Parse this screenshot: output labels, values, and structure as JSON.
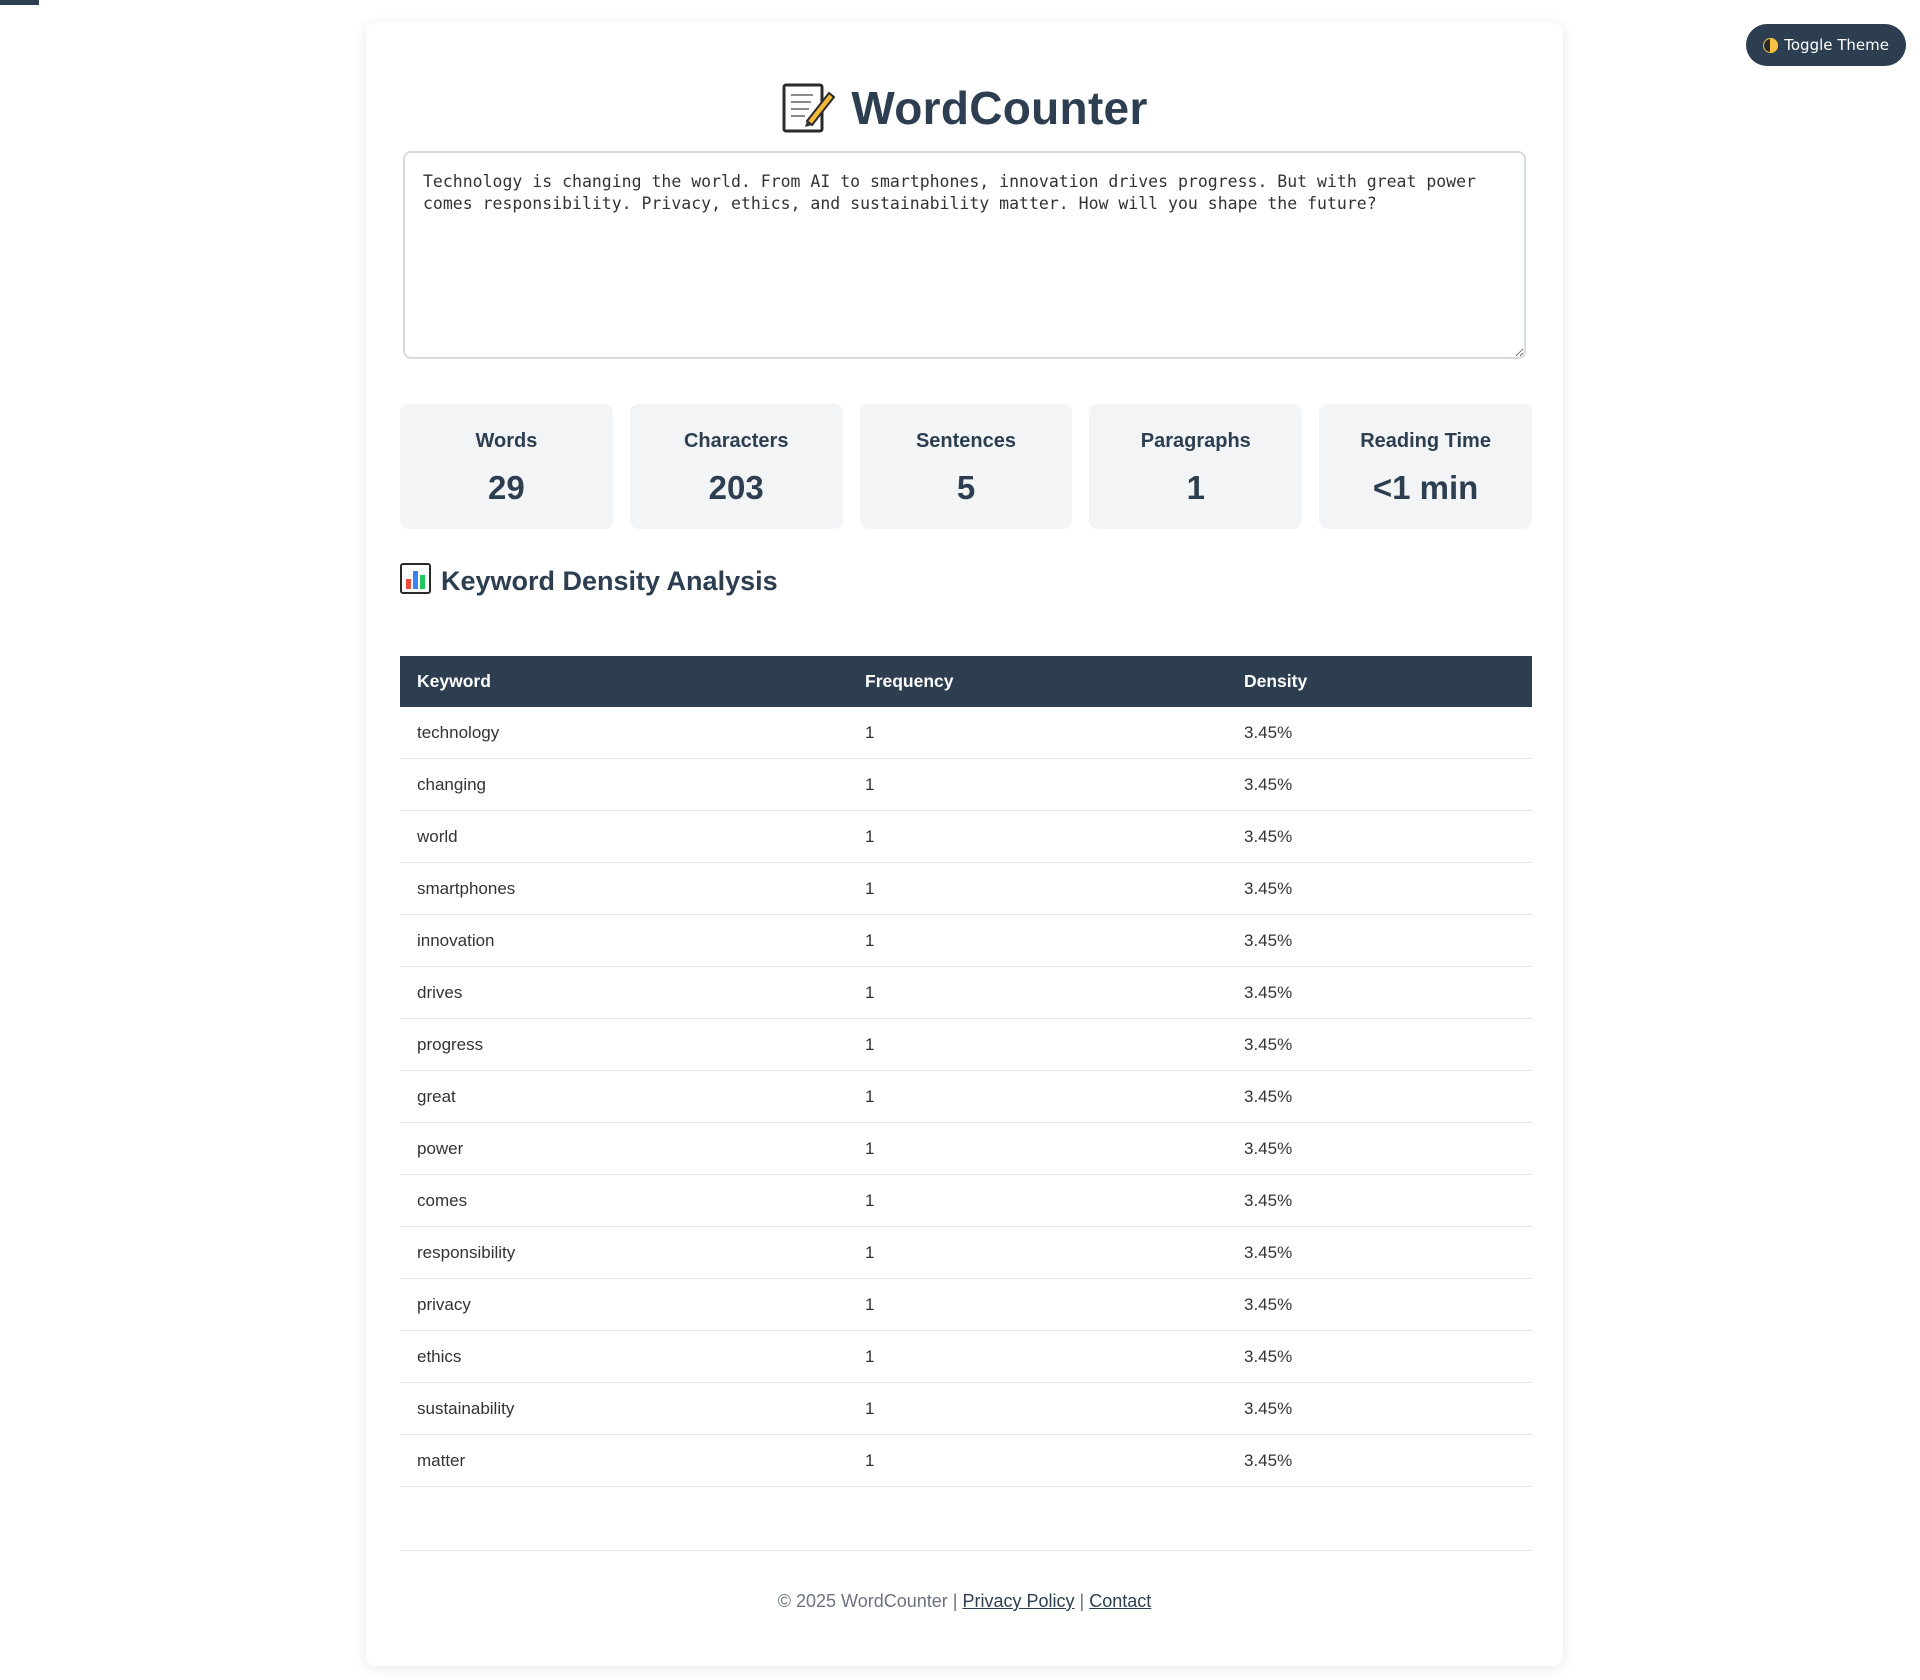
{
  "theme_toggle": {
    "label": "Toggle Theme"
  },
  "app": {
    "title": "WordCounter"
  },
  "editor": {
    "value": "Technology is changing the world. From AI to smartphones, innovation drives progress. But with great power comes responsibility. Privacy, ethics, and sustainability matter. How will you shape the future?"
  },
  "stats": [
    {
      "label": "Words",
      "value": "29"
    },
    {
      "label": "Characters",
      "value": "203"
    },
    {
      "label": "Sentences",
      "value": "5"
    },
    {
      "label": "Paragraphs",
      "value": "1"
    },
    {
      "label": "Reading Time",
      "value": "<1 min"
    }
  ],
  "keyword_section": {
    "title": "Keyword Density Analysis",
    "columns": [
      "Keyword",
      "Frequency",
      "Density"
    ],
    "rows": [
      [
        "technology",
        "1",
        "3.45%"
      ],
      [
        "changing",
        "1",
        "3.45%"
      ],
      [
        "world",
        "1",
        "3.45%"
      ],
      [
        "smartphones",
        "1",
        "3.45%"
      ],
      [
        "innovation",
        "1",
        "3.45%"
      ],
      [
        "drives",
        "1",
        "3.45%"
      ],
      [
        "progress",
        "1",
        "3.45%"
      ],
      [
        "great",
        "1",
        "3.45%"
      ],
      [
        "power",
        "1",
        "3.45%"
      ],
      [
        "comes",
        "1",
        "3.45%"
      ],
      [
        "responsibility",
        "1",
        "3.45%"
      ],
      [
        "privacy",
        "1",
        "3.45%"
      ],
      [
        "ethics",
        "1",
        "3.45%"
      ],
      [
        "sustainability",
        "1",
        "3.45%"
      ],
      [
        "matter",
        "1",
        "3.45%"
      ]
    ]
  },
  "footer": {
    "copyright": "© 2025 WordCounter",
    "separator": "|",
    "privacy_label": "Privacy Policy",
    "contact_label": "Contact"
  },
  "icons": {
    "title": "memo-icon",
    "section": "bar-chart-icon",
    "theme": "half-moon-icon"
  },
  "colors": {
    "primary": "#2c3e50",
    "stat_bg": "#f3f4f6",
    "border": "#d7dbdf"
  }
}
